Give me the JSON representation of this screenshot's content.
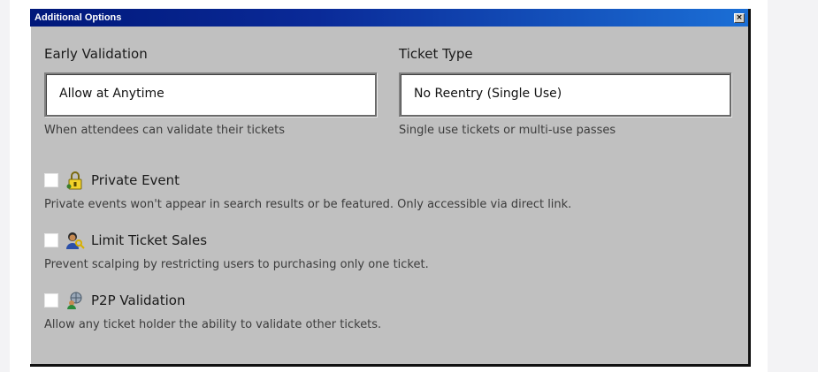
{
  "window": {
    "title": "Additional Options",
    "close_label": "×"
  },
  "early_validation": {
    "label": "Early Validation",
    "selected": "Allow at Anytime",
    "helper": "When attendees can validate their tickets"
  },
  "ticket_type": {
    "label": "Ticket Type",
    "selected": "No Reentry (Single Use)",
    "helper": "Single use tickets or multi-use passes"
  },
  "options": [
    {
      "label": "Private Event",
      "icon": "lock-icon",
      "checked": false,
      "description": "Private events won't appear in search results or be featured. Only accessible via direct link."
    },
    {
      "label": "Limit Ticket Sales",
      "icon": "user-key-icon",
      "checked": false,
      "description": "Prevent scalping by restricting users to purchasing only one ticket."
    },
    {
      "label": "P2P Validation",
      "icon": "network-user-icon",
      "checked": false,
      "description": "Allow any ticket holder the ability to validate other tickets."
    }
  ]
}
